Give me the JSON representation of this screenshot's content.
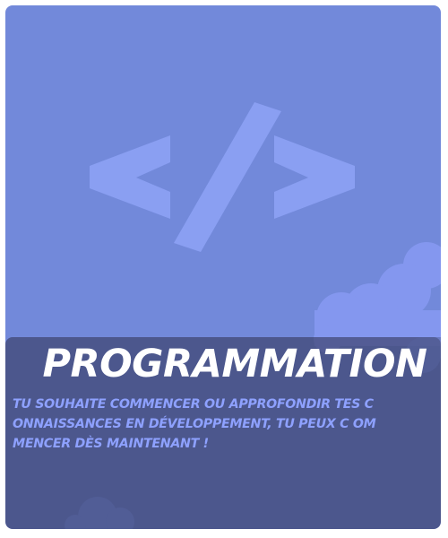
{
  "card": {
    "title": "PROGRAMMATION",
    "description": "TU SOUHAITE COMMENCER OU APPROFONDIR TES CONNAISSANCES EN DÉVELOPPEMENT, TU PEUX C OMMENCER DÈS MAINTENANT !",
    "icon": "code-brackets-icon"
  },
  "colors": {
    "card_background": "#7289da",
    "icon_color": "#8ea0f0",
    "cloud_color": "#8396f0",
    "overlay_color": "#3a4073",
    "title_color": "#ffffff",
    "description_color": "#8ea1ff"
  }
}
